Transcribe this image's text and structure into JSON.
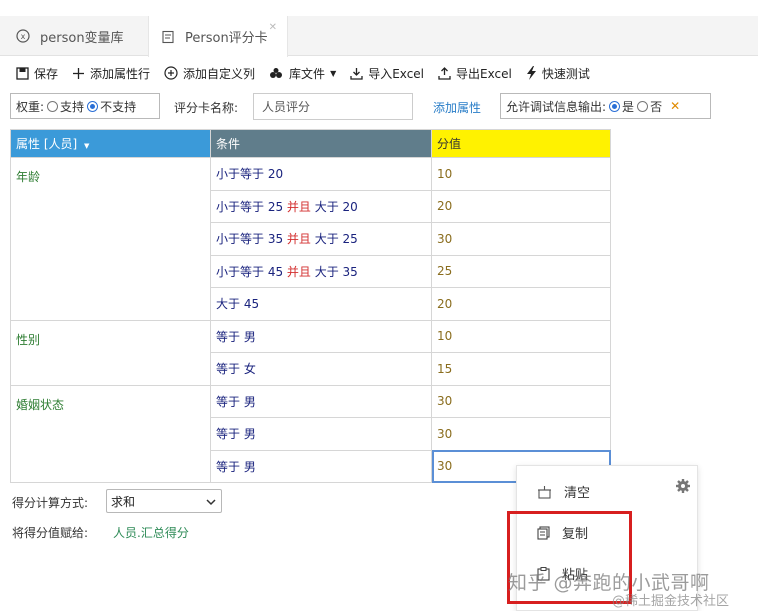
{
  "tabs": [
    {
      "label": "person变量库",
      "icon": "variable-icon"
    },
    {
      "label": "Person评分卡",
      "icon": "scorecard-icon"
    }
  ],
  "toolbar": {
    "save": "保存",
    "add_attr_row": "添加属性行",
    "add_custom_col": "添加自定义列",
    "lib_file": "库文件",
    "import_excel": "导入Excel",
    "export_excel": "导出Excel",
    "quick_test": "快速测试"
  },
  "settings": {
    "weight_label": "权重:",
    "weight_options": [
      "支持",
      "不支持"
    ],
    "weight_selected": "不支持",
    "card_name_label": "评分卡名称:",
    "card_name_value": "人员评分",
    "add_attr_link": "添加属性",
    "debug_label": "允许调试信息输出:",
    "debug_options": [
      "是",
      "否"
    ],
    "debug_selected": "是"
  },
  "table": {
    "headers": [
      "属性 [人员]",
      "条件",
      "分值"
    ],
    "groups": [
      {
        "attr": "年龄",
        "rows": [
          {
            "cond": [
              {
                "t": "小于等于 20"
              }
            ],
            "score": "10"
          },
          {
            "cond": [
              {
                "t": "小于等于 25 "
              },
              {
                "t": "并且",
                "kw": true
              },
              {
                "t": " 大于 20"
              }
            ],
            "score": "20"
          },
          {
            "cond": [
              {
                "t": "小于等于 35 "
              },
              {
                "t": "并且",
                "kw": true
              },
              {
                "t": " 大于 25"
              }
            ],
            "score": "30"
          },
          {
            "cond": [
              {
                "t": "小于等于 45 "
              },
              {
                "t": "并且",
                "kw": true
              },
              {
                "t": " 大于 35"
              }
            ],
            "score": "25"
          },
          {
            "cond": [
              {
                "t": "大于 45"
              }
            ],
            "score": "20"
          }
        ]
      },
      {
        "attr": "性别",
        "rows": [
          {
            "cond": [
              {
                "t": "等于 男"
              }
            ],
            "score": "10"
          },
          {
            "cond": [
              {
                "t": "等于 女"
              }
            ],
            "score": "15"
          }
        ]
      },
      {
        "attr": "婚姻状态",
        "rows": [
          {
            "cond": [
              {
                "t": "等于 男"
              }
            ],
            "score": "30"
          },
          {
            "cond": [
              {
                "t": "等于 男"
              }
            ],
            "score": "30"
          },
          {
            "cond": [
              {
                "t": "等于 男"
              }
            ],
            "score": "30"
          }
        ]
      }
    ]
  },
  "bottom": {
    "calc_label": "得分计算方式:",
    "calc_value": "求和",
    "assign_label": "将得分值赋给:",
    "assign_value": "人员.汇总得分"
  },
  "context_menu": {
    "items": [
      "清空",
      "复制",
      "粘贴"
    ]
  },
  "watermark": {
    "line1": "知乎 @奔跑的小武哥啊",
    "line2": "@稀土掘金技术社区"
  },
  "colors": {
    "attr_header": "#3b9ad9",
    "cond_header": "#607d8b",
    "score_header": "#fff200",
    "highlight_box": "#d71f1f"
  }
}
